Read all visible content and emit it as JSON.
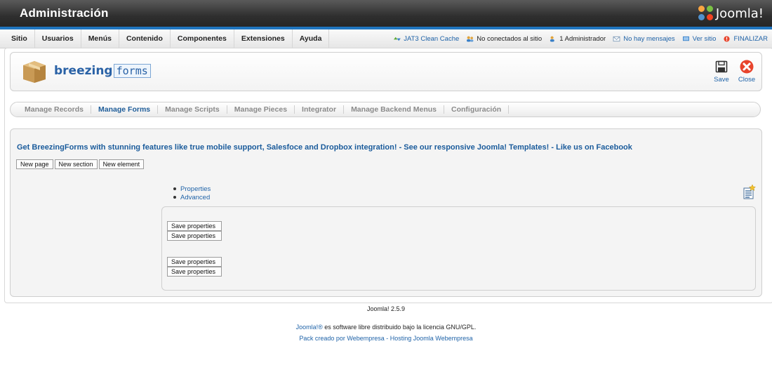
{
  "header": {
    "title": "Administración",
    "logo_text": "Joomla!"
  },
  "menu": {
    "items": [
      "Sitio",
      "Usuarios",
      "Menús",
      "Contenido",
      "Componentes",
      "Extensiones",
      "Ayuda"
    ]
  },
  "status": {
    "cache": "JAT3 Clean Cache",
    "visitors": "No conectados al sitio",
    "admins": "1 Administrador",
    "messages": "No hay mensajes",
    "view_site": "Ver sitio",
    "logout": "FINALIZAR"
  },
  "toolbar": {
    "logo_part1": "breezing",
    "logo_part2": "forms",
    "save_label": "Save",
    "close_label": "Close"
  },
  "submenu": {
    "tabs": [
      "Manage Records",
      "Manage Forms",
      "Manage Scripts",
      "Manage Pieces",
      "Integrator",
      "Manage Backend Menus",
      "Configuración"
    ],
    "active": "Manage Forms"
  },
  "main": {
    "promo": "Get BreezingForms with stunning features like true mobile support, Salesfoce and Dropbox integration! - See our responsive Joomla! Templates! - Like us on Facebook",
    "buttons": [
      "New page",
      "New section",
      "New element"
    ],
    "links": [
      "Properties",
      "Advanced"
    ],
    "save_properties": [
      "Save properties",
      "Save properties",
      "Save properties",
      "Save properties"
    ]
  },
  "footer": {
    "version": "Joomla! 2.5.9",
    "license_link": "Joomla!®",
    "license_text": " es software libre distribuido bajo la licencia GNU/GPL.",
    "pack": "Pack creado por Webempresa - Hosting Joomla Webempresa"
  },
  "colors": {
    "accent_blue": "#1f75bf",
    "link_blue": "#1f63a8",
    "close_red": "#e8442c"
  }
}
